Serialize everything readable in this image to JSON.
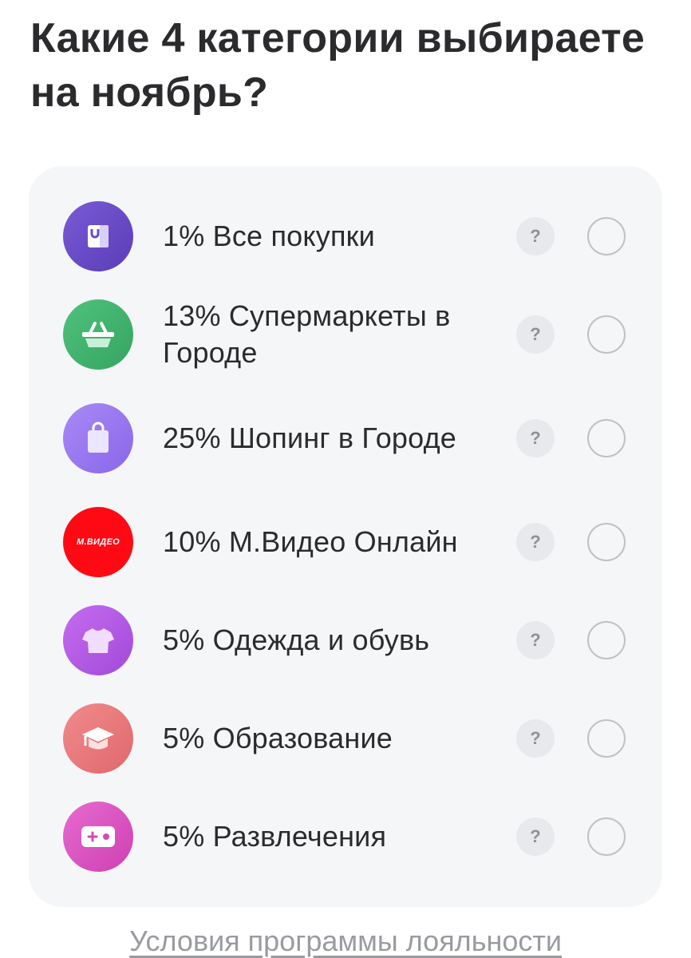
{
  "title": "Какие 4 категории выбираете на ноябрь?",
  "categories": [
    {
      "label": "1% Все покупки",
      "icon": "shopping-bag-icon",
      "color": "#6e4fc9"
    },
    {
      "label": "13% Супермаркеты в Городе",
      "icon": "basket-icon",
      "color": "#43b36f"
    },
    {
      "label": "25% Шопинг в Городе",
      "icon": "shopping-bag-icon",
      "color": "#9a79f0"
    },
    {
      "label": "10% М.Видео Онлайн",
      "icon": "mvideo-logo",
      "color": "#ff0a14",
      "logo_text": "М.ВИДЕО"
    },
    {
      "label": "5% Одежда и обувь",
      "icon": "tshirt-icon",
      "color": "#b45de8"
    },
    {
      "label": "5% Образование",
      "icon": "graduation-cap-icon",
      "color": "#ec7c7e"
    },
    {
      "label": "5% Развлечения",
      "icon": "gamepad-icon",
      "color": "#dc56c4"
    }
  ],
  "help_symbol": "?",
  "footer_link": "Условия программы лояльности"
}
